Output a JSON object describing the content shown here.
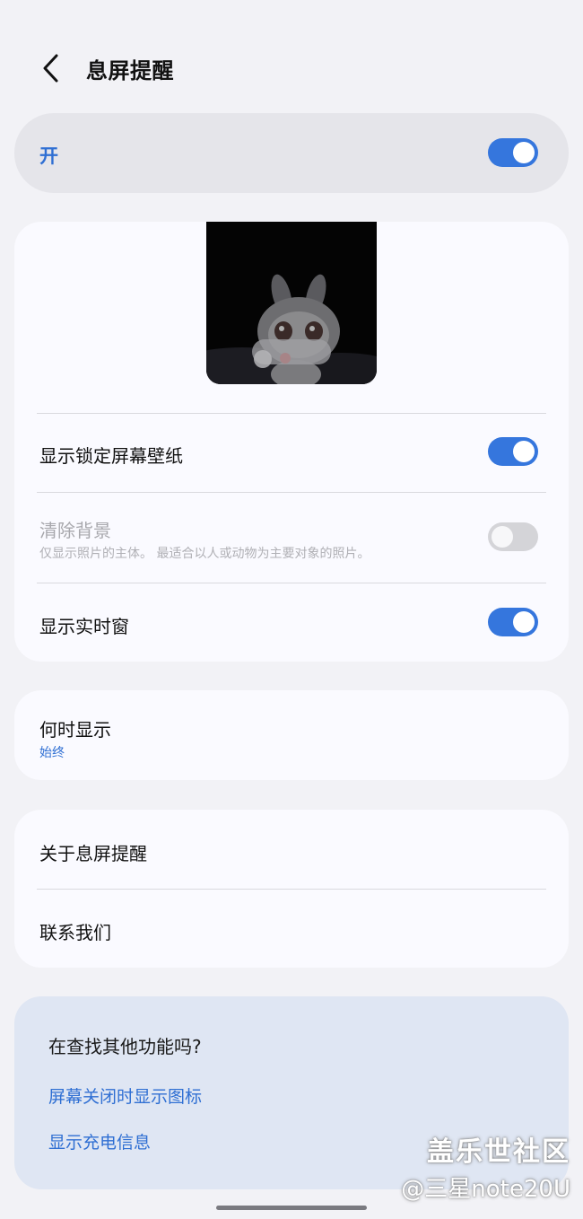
{
  "header": {
    "title": "息屏提醒",
    "back_icon": "chevron-left-icon"
  },
  "master": {
    "label": "开",
    "enabled": true
  },
  "display_card": {
    "wallpaper_label": "显示锁定屏幕壁纸",
    "wallpaper_enabled": true,
    "clear_bg_label": "清除背景",
    "clear_bg_sub": "仅显示照片的主体。 最适合以人或动物为主要对象的照片。",
    "clear_bg_enabled": false,
    "live_window_label": "显示实时窗",
    "live_window_enabled": true
  },
  "when_card": {
    "label": "何时显示",
    "value": "始终"
  },
  "info_card": {
    "about_label": "关于息屏提醒",
    "contact_label": "联系我们"
  },
  "suggest": {
    "title": "在查找其他功能吗?",
    "links": [
      "屏幕关闭时显示图标",
      "显示充电信息"
    ]
  },
  "watermark": {
    "line1": "盖乐世社区",
    "line2": "@三星note20U"
  },
  "colors": {
    "accent": "#3576dd",
    "link": "#2f6fd3",
    "background": "#f2f2f6",
    "card": "#fafaff"
  }
}
